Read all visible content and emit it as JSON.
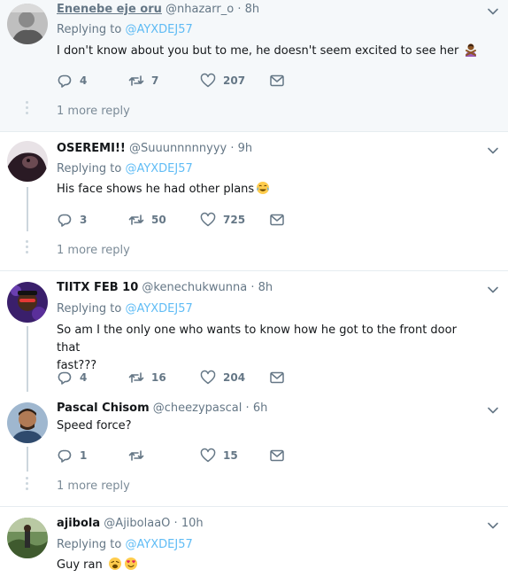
{
  "tweets": [
    {
      "name": "Enenebe eje oru",
      "handle": "@nhazarr_o",
      "time": "8h",
      "reply_label": "Replying to",
      "reply_to": "@AYXDEJ57",
      "text": "I don't know about you but to me, he doesn't seem excited to see her",
      "emoji": [
        "person-gesturing-no-emoji"
      ],
      "replies": "4",
      "retweets": "7",
      "likes": "207",
      "more": "1 more reply"
    },
    {
      "name": "OSEREMI!!",
      "handle": "@Suuunnnnnyyy",
      "time": "9h",
      "reply_label": "Replying to",
      "reply_to": "@AYXDEJ57",
      "text": "His face shows he had other plans",
      "emoji": [
        "tears-of-joy-emoji"
      ],
      "replies": "3",
      "retweets": "50",
      "likes": "725",
      "more": "1 more reply"
    },
    {
      "name": "TIITX FEB 10",
      "handle": "@kenechukwunna",
      "time": "8h",
      "reply_label": "Replying to",
      "reply_to": "@AYXDEJ57",
      "text_line1": "So am I the only one who wants to know how he got to the front door that",
      "text_line2": "fast???",
      "replies": "4",
      "retweets": "16",
      "likes": "204"
    },
    {
      "name": "Pascal Chisom",
      "handle": "@cheezypascal",
      "time": "6h",
      "text": "Speed force?",
      "replies": "1",
      "retweets": "",
      "likes": "15",
      "more": "1 more reply"
    },
    {
      "name": "ajibola",
      "handle": "@AjibolaaO",
      "time": "10h",
      "reply_label": "Replying to",
      "reply_to": "@AYXDEJ57",
      "text": "Guy ran",
      "emoji": [
        "weary-face-emoji",
        "heart-eyes-emoji"
      ]
    }
  ],
  "separator": "·",
  "colors": {
    "accent": "#1da1f2",
    "muted": "#657786",
    "text": "#14171a",
    "highlight_bg": "#f5f8fa",
    "divider": "#e6ecf0"
  },
  "icons": {
    "reply": "reply-icon",
    "retweet": "retweet-icon",
    "like": "heart-icon",
    "dm": "envelope-icon",
    "menu": "chevron-down-icon"
  }
}
